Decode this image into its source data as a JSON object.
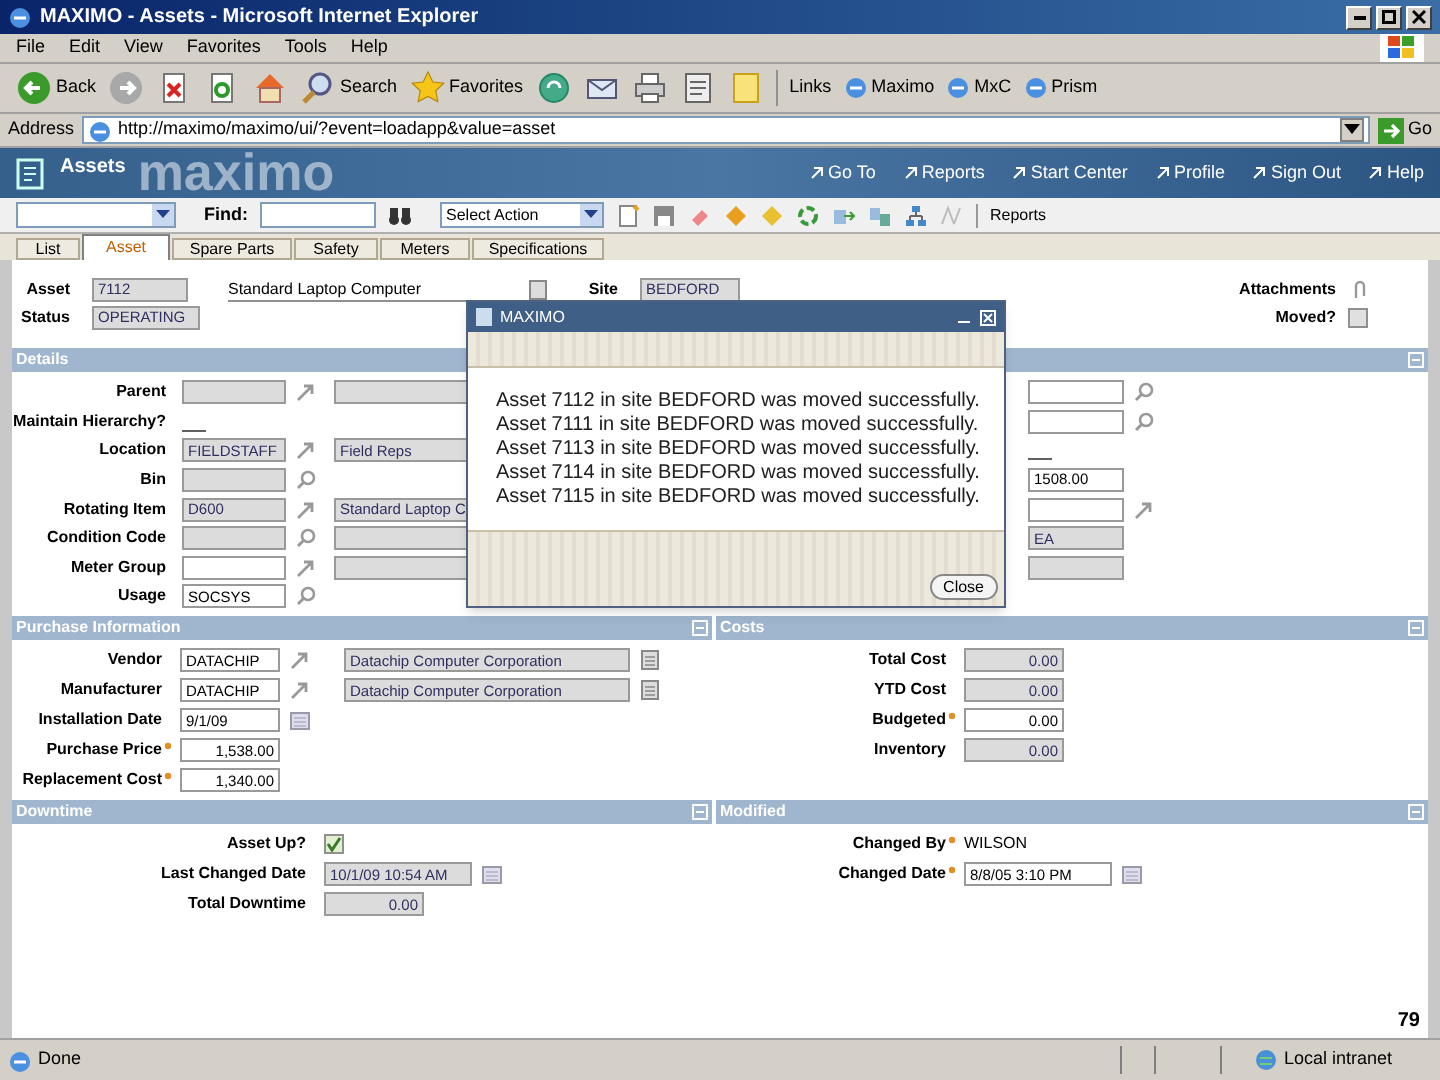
{
  "window": {
    "title": "MAXIMO - Assets - Microsoft Internet Explorer"
  },
  "menu_bar": [
    "File",
    "Edit",
    "View",
    "Favorites",
    "Tools",
    "Help"
  ],
  "browser_toolbar": [
    {
      "kind": "back",
      "label": "Back"
    },
    {
      "kind": "forward"
    },
    {
      "kind": "stop"
    },
    {
      "kind": "refresh"
    },
    {
      "kind": "home"
    },
    {
      "kind": "search",
      "label": "Search"
    },
    {
      "kind": "favorites",
      "label": "Favorites"
    },
    {
      "kind": "media"
    },
    {
      "kind": "mail"
    },
    {
      "kind": "print"
    },
    {
      "kind": "edit"
    },
    {
      "kind": "note"
    }
  ],
  "links": {
    "label": "Links",
    "items": [
      "Maximo",
      "MxC",
      "Prism"
    ]
  },
  "address_bar": {
    "label": "Address",
    "url": "http://maximo/maximo/ui/?event=loadapp&value=asset",
    "go": "Go"
  },
  "app_header": {
    "title": "Assets",
    "brand": "maximo",
    "links": [
      "Go To",
      "Reports",
      "Start Center",
      "Profile",
      "Sign Out",
      "Help"
    ]
  },
  "app_toolbar": {
    "find_label": "Find:",
    "action_select": "Select Action",
    "reports": "Reports"
  },
  "tabs": [
    {
      "label": "List",
      "selected": false
    },
    {
      "label": "Asset",
      "selected": true
    },
    {
      "label": "Spare Parts",
      "selected": false
    },
    {
      "label": "Safety",
      "selected": false
    },
    {
      "label": "Meters",
      "selected": false
    },
    {
      "label": "Specifications",
      "selected": false
    }
  ],
  "record": {
    "asset_label": "Asset",
    "asset": "7112",
    "description": "Standard Laptop Computer",
    "site_label": "Site",
    "site": "BEDFORD",
    "status_label": "Status",
    "status": "OPERATING",
    "attachments": "Attachments",
    "moved_label": "Moved?",
    "moved": false
  },
  "details": {
    "title": "Details",
    "rows": [
      {
        "label": "Parent",
        "field": {
          "readonly": true,
          "button": {
            "kind": "go_to"
          }
        },
        "description": {
          "readonly": true
        },
        "right": {
          "readonly": false,
          "button": {
            "kind": "lookup"
          }
        }
      },
      {
        "label": "Maintain Hierarchy?",
        "field": {
          "kind": "underline"
        },
        "right": {
          "readonly": false,
          "button": {
            "kind": "lookup"
          }
        }
      },
      {
        "label": "Location",
        "field": {
          "value": "FIELDSTAFF",
          "readonly": true,
          "button": {
            "kind": "go_to"
          }
        },
        "description": {
          "value": "Field Reps",
          "readonly": true
        },
        "right": {
          "kind": "underline"
        }
      },
      {
        "label": "Bin",
        "field": {
          "readonly": true,
          "button": {
            "kind": "lookup"
          }
        },
        "right": {
          "value": "1508.00",
          "readonly": false
        }
      },
      {
        "label": "Rotating Item",
        "field": {
          "value": "D600",
          "readonly": true,
          "button": {
            "kind": "go_to"
          }
        },
        "description": {
          "value": "Standard Laptop C",
          "readonly": true
        },
        "right": {
          "readonly": false,
          "button": {
            "kind": "go_to"
          }
        }
      },
      {
        "label": "Condition Code",
        "field": {
          "readonly": true,
          "button": {
            "kind": "lookup"
          }
        },
        "description": {
          "readonly": true
        },
        "right": {
          "value": "EA",
          "readonly": true
        }
      },
      {
        "label": "Meter Group",
        "field": {
          "readonly": false,
          "button": {
            "kind": "go_to"
          }
        },
        "description": {
          "readonly": true
        },
        "right": {
          "readonly": true
        }
      },
      {
        "label": "Usage",
        "field": {
          "value": "SOCSYS",
          "readonly": false,
          "button": {
            "kind": "lookup"
          }
        }
      }
    ]
  },
  "dialog": {
    "title": "MAXIMO",
    "messages": [
      "Asset 7112 in site BEDFORD was moved successfully.",
      "Asset 7111 in site BEDFORD was moved successfully.",
      "Asset 7113 in site BEDFORD was moved successfully.",
      "Asset 7114 in site BEDFORD was moved successfully.",
      "Asset 7115 in site BEDFORD was moved successfully."
    ],
    "button": "Close"
  },
  "purchase": {
    "title": "Purchase Information",
    "rows": [
      {
        "label": "Vendor",
        "field": {
          "value": "DATACHIP",
          "readonly": false,
          "button": {
            "kind": "go_to"
          }
        },
        "description": {
          "value": "Datachip Computer Corporation",
          "readonly": true,
          "button": {
            "kind": "long_description"
          }
        }
      },
      {
        "label": "Manufacturer",
        "field": {
          "value": "DATACHIP",
          "readonly": false,
          "button": {
            "kind": "go_to"
          }
        },
        "description": {
          "value": "Datachip Computer Corporation",
          "readonly": true,
          "button": {
            "kind": "long_description"
          }
        }
      },
      {
        "label": "Installation Date",
        "field": {
          "value": "9/1/09",
          "readonly": false,
          "button": {
            "kind": "calendar"
          }
        }
      },
      {
        "label": "Purchase Price",
        "required": true,
        "field": {
          "value": "1,538.00",
          "readonly": false,
          "kind": "number"
        }
      },
      {
        "label": "Replacement Cost",
        "required": true,
        "field": {
          "value": "1,340.00",
          "readonly": false,
          "kind": "number"
        }
      }
    ]
  },
  "costs": {
    "title": "Costs",
    "rows": [
      {
        "label": "Total Cost",
        "field": {
          "value": "0.00",
          "readonly": true,
          "kind": "number"
        }
      },
      {
        "label": "YTD Cost",
        "field": {
          "value": "0.00",
          "readonly": true,
          "kind": "number"
        }
      },
      {
        "label": "Budgeted",
        "required": true,
        "field": {
          "value": "0.00",
          "readonly": false,
          "kind": "number"
        }
      },
      {
        "label": "Inventory",
        "field": {
          "value": "0.00",
          "readonly": true,
          "kind": "number"
        }
      }
    ]
  },
  "downtime": {
    "title": "Downtime",
    "rows": [
      {
        "label": "Asset Up?",
        "field": {
          "kind": "checkbox",
          "checked": true
        }
      },
      {
        "label": "Last Changed Date",
        "field": {
          "value": "10/1/09 10:54 AM",
          "readonly": true,
          "button": {
            "kind": "calendar"
          }
        }
      },
      {
        "label": "Total Downtime",
        "field": {
          "value": "0.00",
          "readonly": true,
          "kind": "number"
        }
      }
    ]
  },
  "modified": {
    "title": "Modified",
    "rows": [
      {
        "label": "Changed By",
        "required": true,
        "field": {
          "kind": "text",
          "value": "WILSON"
        }
      },
      {
        "label": "Changed Date",
        "required": true,
        "field": {
          "value": "8/8/05 3:10 PM",
          "readonly": false,
          "button": {
            "kind": "calendar"
          }
        }
      }
    ]
  },
  "status_bar": {
    "text": "Done",
    "zone": "Local intranet"
  },
  "page_number": "79"
}
